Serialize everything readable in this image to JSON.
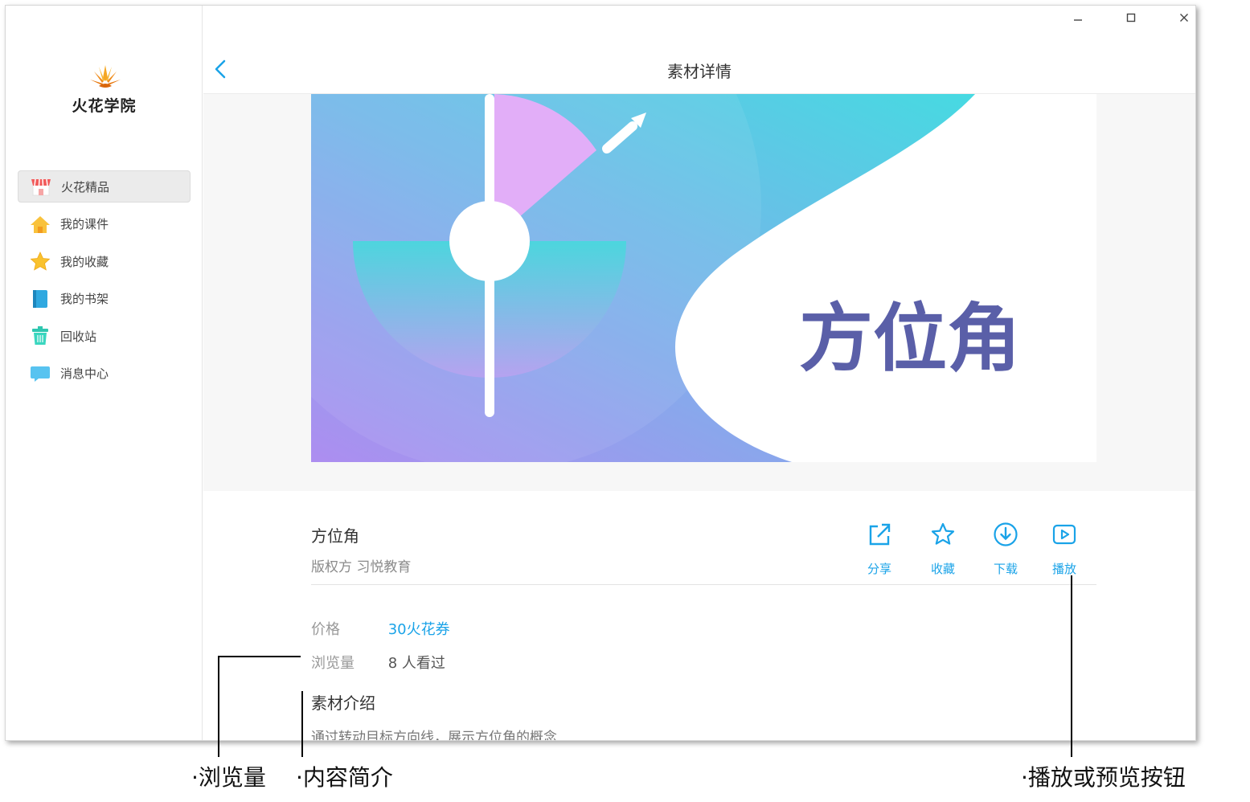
{
  "app": {
    "logo_text": "火花学院",
    "window_controls": [
      "minimize-icon",
      "maximize-icon",
      "close-icon"
    ]
  },
  "sidebar": {
    "items": [
      {
        "label": "火花精品",
        "icon": "store-icon",
        "active": true
      },
      {
        "label": "我的课件",
        "icon": "home-icon",
        "active": false
      },
      {
        "label": "我的收藏",
        "icon": "star-icon",
        "active": false
      },
      {
        "label": "我的书架",
        "icon": "book-icon",
        "active": false
      },
      {
        "label": "回收站",
        "icon": "trash-icon",
        "active": false
      },
      {
        "label": "消息中心",
        "icon": "message-icon",
        "active": false
      }
    ]
  },
  "header": {
    "title": "素材详情",
    "back_icon": "chevron-left-icon"
  },
  "banner": {
    "title": "方位角"
  },
  "detail": {
    "title": "方位角",
    "copyright": "版权方 习悦教育",
    "actions": [
      {
        "label": "分享",
        "icon": "share-icon"
      },
      {
        "label": "收藏",
        "icon": "star-outline-icon"
      },
      {
        "label": "下载",
        "icon": "download-icon"
      },
      {
        "label": "播放",
        "icon": "play-icon"
      }
    ],
    "price_label": "价格",
    "price_value": "30火花券",
    "views_label": "浏览量",
    "views_value": "8 人看过",
    "intro_title": "素材介绍",
    "intro_text": "通过转动目标方向线，展示方位角的概念"
  },
  "annotations": {
    "views": "浏览量",
    "intro": "内容简介",
    "play": "播放或预览按钮"
  },
  "colors": {
    "accent": "#1aa3e8",
    "banner_text": "#5a5fa8"
  }
}
